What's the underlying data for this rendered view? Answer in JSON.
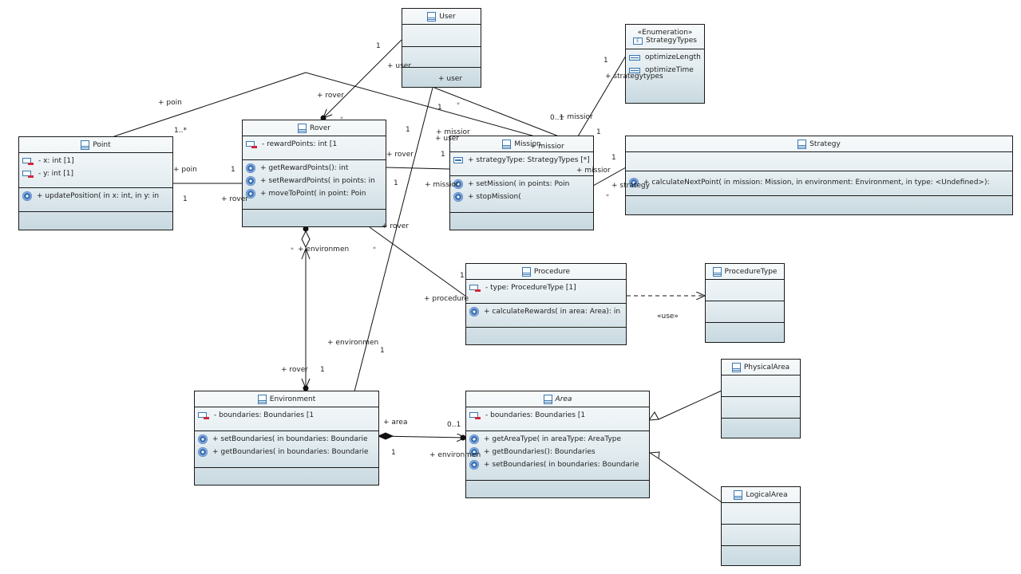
{
  "diagram": {
    "classes": {
      "user": {
        "name": "User",
        "attributes": [],
        "operations": []
      },
      "point": {
        "name": "Point",
        "attributes": [
          "- x: int [1]",
          "- y: int [1]"
        ],
        "operations": [
          "+ updatePosition(  in x: int,   in y: in"
        ]
      },
      "rover": {
        "name": "Rover",
        "attributes": [
          "- rewardPoints: int [1"
        ],
        "operations": [
          "+ getRewardPoints(): int",
          "+ setRewardPoints(  in points: in",
          "+ moveToPoint(  in point: Poin"
        ]
      },
      "mission": {
        "name": "Mission",
        "attributes": [
          "+ strategyType: StrategyTypes [*]"
        ],
        "operations": [
          "+ setMission(  in points: Poin",
          "+ stopMission("
        ]
      },
      "strategy_types": {
        "stereotype": "«Enumeration»",
        "name": "StrategyTypes",
        "literals": [
          "optimizeLength",
          "optimizeTime"
        ]
      },
      "strategy": {
        "name": "Strategy",
        "attributes": [],
        "operations": [
          "+ calculateNextPoint(  in mission: Mission,   in environment: Environment,   in type: <Undefined>):"
        ]
      },
      "procedure": {
        "name": "Procedure",
        "attributes": [
          "- type: ProcedureType [1]"
        ],
        "operations": [
          "+ calculateRewards(  in area: Area): in"
        ]
      },
      "procedure_type": {
        "name": "ProcedureType",
        "attributes": [],
        "operations": []
      },
      "environment": {
        "name": "Environment",
        "attributes": [
          "- boundaries: Boundaries [1"
        ],
        "operations": [
          "+ setBoundaries(  in boundaries: Boundarie",
          "+ getBoundaries(  in boundaries: Boundarie"
        ]
      },
      "area": {
        "name": "Area",
        "abstract": true,
        "attributes": [
          "- boundaries: Boundaries [1"
        ],
        "operations": [
          "+ getAreaType(  in areaType: AreaType",
          "+ getBoundaries(): Boundaries",
          "+ setBoundaries(  in boundaries: Boundarie"
        ]
      },
      "physical_area": {
        "name": "PhysicalArea",
        "attributes": [],
        "operations": []
      },
      "logical_area": {
        "name": "LogicalArea",
        "attributes": [],
        "operations": []
      }
    },
    "labels": {
      "user_rover_mult_user": "1",
      "user_rover_role_user": "+ user",
      "user_rover_role_rover": "+ rover",
      "user_rover_mult_rover": "*",
      "user_inner_role": "+ user",
      "user_mission_mult_user": "1",
      "user_mission_mult_mission": "*",
      "user_mission_role_mission": "+ missior",
      "user_mission_role_user": "+ user",
      "point_mission_role_point": "+ poin",
      "point_mission_mult_point": "1..*",
      "point_mission_mult_mission": "1",
      "point_rover_role_point": "+ poin",
      "point_rover_mult_point": "1",
      "point_rover_mult_rover": "1",
      "point_rover_role_rover": "+ rover",
      "rover_mission_role_rover": "+ rover",
      "rover_mission_mult_rover": "1",
      "rover_mission_mult_mission": "1",
      "rover_mission_role_mission": "+ missior",
      "rover_mission_mult_1b": "1",
      "mission_enum_mult_mission": "0..1",
      "mission_enum_role_mission": "+ missior",
      "mission_enum_mult_enum": "1",
      "mission_enum_role_enum": "+ strategytypes",
      "mission_header_role": "+ missior",
      "mission_strategy_mult_mission": "1",
      "mission_strategy_role_mission": "+ missior",
      "mission_strategy_mult_mission2": "1",
      "mission_strategy_role_strategy": "+ strategy",
      "mission_strategy_mult_strategy": "*",
      "rover_procedure_role_rover": "+ rover",
      "rover_procedure_mult_rover": "*",
      "rover_procedure_mult_procedure": "1",
      "rover_procedure_role_procedure": "+ procedure",
      "rover_env_mult_env": "*",
      "rover_env_role_env": "+ environmen",
      "rover_env_role_rover": "+ rover",
      "rover_env_mult_rover": "1",
      "user_env_role_env": "+ environmen",
      "user_env_mult_env": "1",
      "env_area_role_area": "+ area",
      "env_area_mult_area": "0..1",
      "env_area_mult_env": "1",
      "env_area_role_env": "+ environmen",
      "use_stereotype": "«use»"
    }
  }
}
